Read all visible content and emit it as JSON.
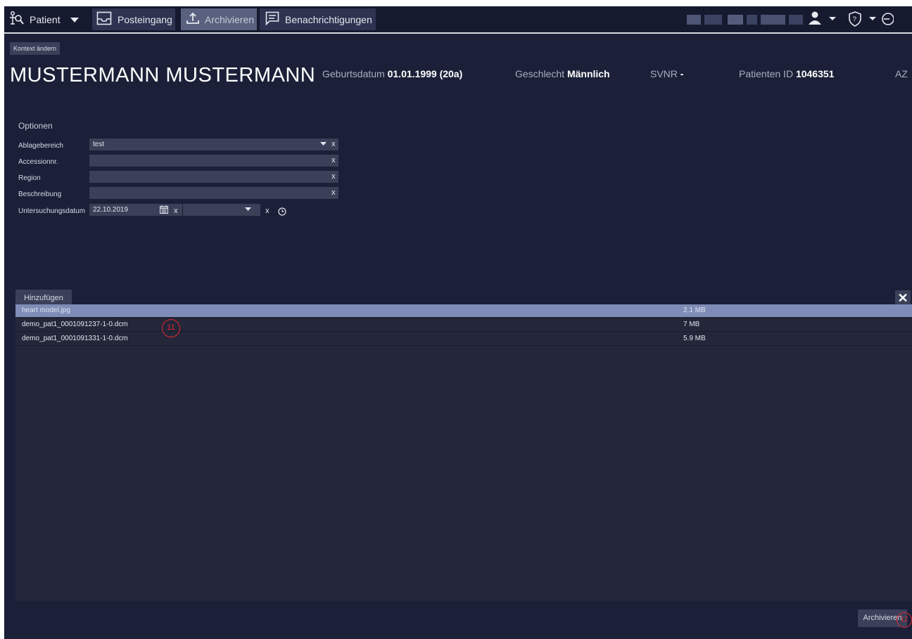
{
  "nav": {
    "patient_label": "Patient",
    "inbox_label": "Posteingang",
    "archive_label": "Archivieren",
    "notifications_label": "Benachrichtigungen"
  },
  "context_button": "Kontext ändern",
  "patient": {
    "name": "MUSTERMANN MUSTERMANN",
    "dob_label": "Geburtsdatum",
    "dob_value": "01.01.1999 (20a)",
    "sex_label": "Geschlecht",
    "sex_value": "Männlich",
    "svnr_label": "SVNR",
    "svnr_value": "-",
    "pid_label": "Patienten ID",
    "pid_value": "1046351",
    "az_label": "AZ"
  },
  "options": {
    "title": "Optionen",
    "fields": [
      {
        "label": "Ablagebereich",
        "value": "test"
      },
      {
        "label": "Accessionnr.",
        "value": ""
      },
      {
        "label": "Region",
        "value": ""
      },
      {
        "label": "Beschreibung",
        "value": ""
      },
      {
        "label": "Untersuchungsdatum",
        "value": "22.10.2019"
      }
    ],
    "clear_symbol": "x"
  },
  "files": {
    "add_label": "Hinzufügen",
    "close_symbol": "✕",
    "rows": [
      {
        "name": "heart model.jpg",
        "size": "2.1 MB",
        "selected": true
      },
      {
        "name": "demo_pat1_0001091237-1-0.dcm",
        "size": "7 MB",
        "selected": false
      },
      {
        "name": "demo_pat1_0001091331-1-0.dcm",
        "size": "5.9 MB",
        "selected": false
      }
    ]
  },
  "archive_button": "Archivieren",
  "annotations": {
    "marker_a": "11",
    "marker_b": "12"
  },
  "colors": {
    "background": "#1b2038",
    "topbar": "#161a2f",
    "selected_row": "#7f8cb7",
    "marker": "#e3262d"
  }
}
